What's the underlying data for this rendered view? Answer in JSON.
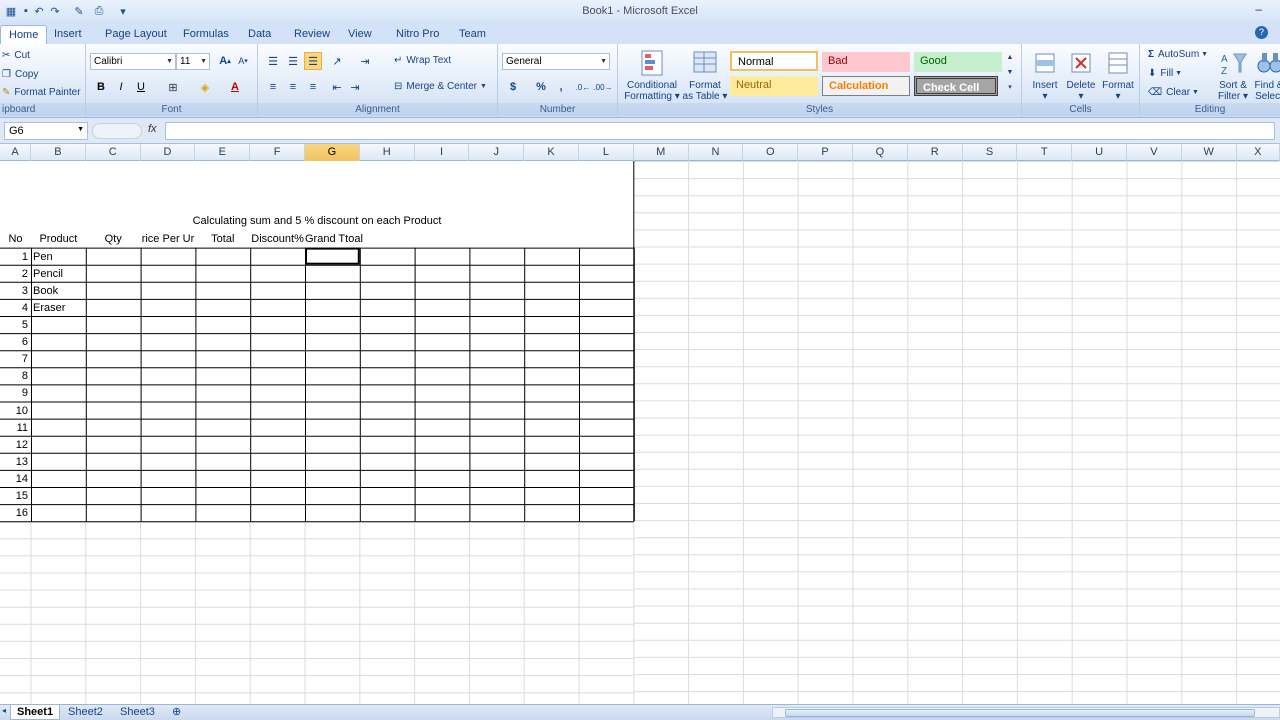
{
  "window": {
    "title": "Book1 - Microsoft Excel"
  },
  "tabs": [
    {
      "label": "Home",
      "active": true
    },
    {
      "label": "Insert"
    },
    {
      "label": "Page Layout"
    },
    {
      "label": "Formulas"
    },
    {
      "label": "Data"
    },
    {
      "label": "Review"
    },
    {
      "label": "View"
    },
    {
      "label": "Nitro Pro"
    },
    {
      "label": "Team"
    }
  ],
  "ribbon": {
    "clipboard": {
      "label": "ipboard",
      "cut": "Cut",
      "copy": "Copy",
      "format_painter": "Format Painter"
    },
    "font": {
      "label": "Font",
      "font_name": "Calibri",
      "font_size": "11",
      "bold": "B",
      "italic": "I",
      "underline": "U",
      "grow": "A",
      "shrink": "A"
    },
    "alignment": {
      "label": "Alignment",
      "wrap_text": "Wrap Text",
      "merge_center": "Merge & Center"
    },
    "number": {
      "label": "Number",
      "format": "General",
      "currency": "$",
      "percent": "%",
      "comma": ","
    },
    "styles": {
      "label": "Styles",
      "conditional_formatting": "Conditional",
      "conditional_formatting_2": "Formatting",
      "format_as_table": "Format",
      "format_as_table_2": "as Table",
      "cell_styles": [
        {
          "label": "Normal",
          "bg": "#ffffff",
          "fg": "#000000"
        },
        {
          "label": "Bad",
          "bg": "#ffc7ce",
          "fg": "#9c0006"
        },
        {
          "label": "Good",
          "bg": "#c6efce",
          "fg": "#006100"
        },
        {
          "label": "Neutral",
          "bg": "#ffeb9c",
          "fg": "#9c6500"
        },
        {
          "label": "Calculation",
          "bg": "#f2f2f2",
          "fg": "#fa7d00"
        },
        {
          "label": "Check Cell",
          "bg": "#a5a5a5",
          "fg": "#ffffff"
        }
      ]
    },
    "cells": {
      "label": "Cells",
      "insert": "Insert",
      "delete": "Delete",
      "format": "Format"
    },
    "editing": {
      "label": "Editing",
      "autosum": "AutoSum",
      "fill": "Fill",
      "clear": "Clear",
      "sort_filter": "Sort &",
      "sort_filter_2": "Filter",
      "find_select": "Find &",
      "find_select_2": "Select"
    }
  },
  "formula_bar": {
    "name_box": "G6",
    "fx": "fx",
    "formula": ""
  },
  "sheet": {
    "columns": [
      "A",
      "B",
      "C",
      "D",
      "E",
      "F",
      "G",
      "H",
      "I",
      "J",
      "K",
      "L",
      "M",
      "N",
      "O",
      "P",
      "Q",
      "R",
      "S",
      "T",
      "U",
      "V",
      "W",
      "X"
    ],
    "selected_column": "G",
    "title": "Calculating sum and 5 % discount on each Product",
    "header_row": [
      "No",
      "Product",
      "Qty",
      "rice Per Ur",
      "Total",
      "Discount%",
      "Grand Ttoal"
    ],
    "rows": [
      {
        "no": "1",
        "product": "Pen"
      },
      {
        "no": "2",
        "product": "Pencil"
      },
      {
        "no": "3",
        "product": "Book"
      },
      {
        "no": "4",
        "product": "Eraser"
      },
      {
        "no": "5",
        "product": ""
      },
      {
        "no": "6",
        "product": ""
      },
      {
        "no": "7",
        "product": ""
      },
      {
        "no": "8",
        "product": ""
      },
      {
        "no": "9",
        "product": ""
      },
      {
        "no": "10",
        "product": ""
      },
      {
        "no": "11",
        "product": ""
      },
      {
        "no": "12",
        "product": ""
      },
      {
        "no": "13",
        "product": ""
      },
      {
        "no": "14",
        "product": ""
      },
      {
        "no": "15",
        "product": ""
      },
      {
        "no": "16",
        "product": ""
      }
    ]
  },
  "sheet_tabs": [
    {
      "label": "Sheet1",
      "active": true
    },
    {
      "label": "Sheet2"
    },
    {
      "label": "Sheet3"
    }
  ]
}
